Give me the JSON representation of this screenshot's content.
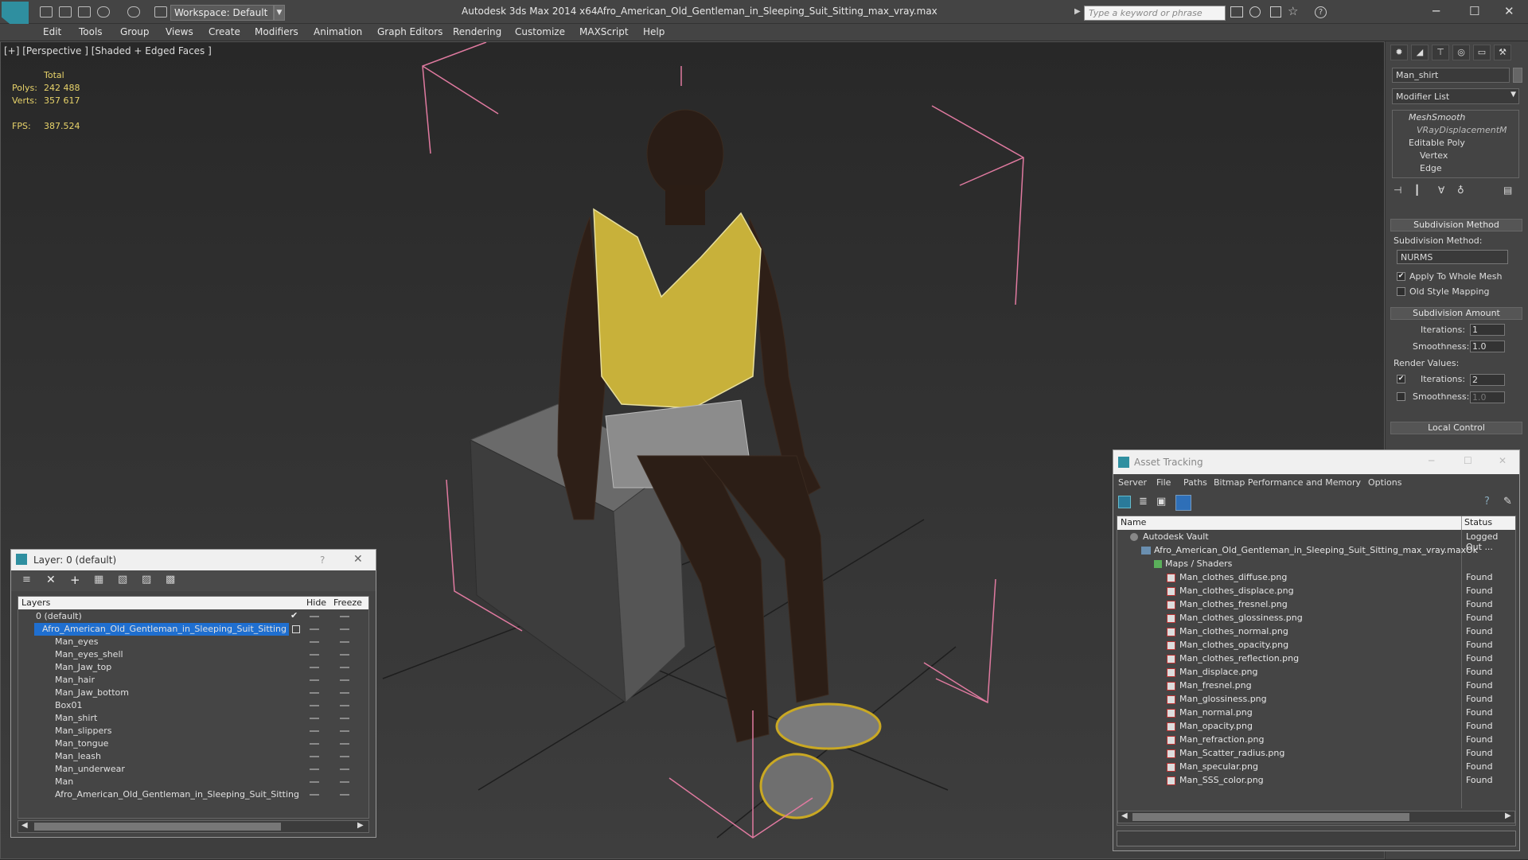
{
  "titlebar": {
    "workspace": "Workspace: Default",
    "app_title": "Autodesk 3ds Max  2014 x64",
    "file_name": "Afro_American_Old_Gentleman_in_Sleeping_Suit_Sitting_max_vray.max",
    "search_placeholder": "Type a keyword or phrase"
  },
  "menu": [
    "Edit",
    "Tools",
    "Group",
    "Views",
    "Create",
    "Modifiers",
    "Animation",
    "Graph Editors",
    "Rendering",
    "Customize",
    "MAXScript",
    "Help"
  ],
  "viewport": {
    "label": "[+] [Perspective ] [Shaded + Edged Faces ]",
    "stats": {
      "total_label": "Total",
      "polys_label": "Polys:",
      "polys": "242 488",
      "verts_label": "Verts:",
      "verts": "357 617",
      "fps_label": "FPS:",
      "fps": "387.524"
    }
  },
  "command_panel": {
    "object_name": "Man_shirt",
    "modifier_list": "Modifier List",
    "stack": [
      "MeshSmooth",
      "VRayDisplacementM",
      "Editable Poly",
      "Vertex",
      "Edge"
    ],
    "subdivision_method_title": "Subdivision Method",
    "subdivision_method_label": "Subdivision Method:",
    "subdivision_method_value": "NURMS",
    "apply_whole_mesh": "Apply To Whole Mesh",
    "old_style_mapping": "Old Style Mapping",
    "subdivision_amount_title": "Subdivision Amount",
    "iterations_label": "Iterations:",
    "iterations_value": "1",
    "smoothness_label": "Smoothness:",
    "smoothness_value": "1.0",
    "render_values_label": "Render Values:",
    "render_iterations_value": "2",
    "render_smoothness_value": "1.0",
    "local_control_title": "Local Control"
  },
  "layer_dialog": {
    "title": "Layer: 0 (default)",
    "help": "?",
    "headers": {
      "layers": "Layers",
      "hide": "Hide",
      "freeze": "Freeze"
    },
    "layers": [
      "0 (default)",
      "Afro_American_Old_Gentleman_in_Sleeping_Suit_Sitting",
      "Man_eyes",
      "Man_eyes_shell",
      "Man_Jaw_top",
      "Man_hair",
      "Man_Jaw_bottom",
      "Box01",
      "Man_shirt",
      "Man_slippers",
      "Man_tongue",
      "Man_leash",
      "Man_underwear",
      "Man",
      "Afro_American_Old_Gentleman_in_Sleeping_Suit_Sitting"
    ]
  },
  "asset_dialog": {
    "title": "Asset Tracking",
    "menu": [
      "Server",
      "File",
      "Paths",
      "Bitmap Performance and Memory",
      "Options"
    ],
    "headers": {
      "name": "Name",
      "status": "Status"
    },
    "rows": [
      {
        "name": "Autodesk Vault",
        "status": "Logged Out ..."
      },
      {
        "name": "Afro_American_Old_Gentleman_in_Sleeping_Suit_Sitting_max_vray.max",
        "status": "Ok"
      },
      {
        "name": "Maps / Shaders",
        "status": ""
      },
      {
        "name": "Man_clothes_diffuse.png",
        "status": "Found"
      },
      {
        "name": "Man_clothes_displace.png",
        "status": "Found"
      },
      {
        "name": "Man_clothes_fresnel.png",
        "status": "Found"
      },
      {
        "name": "Man_clothes_glossiness.png",
        "status": "Found"
      },
      {
        "name": "Man_clothes_normal.png",
        "status": "Found"
      },
      {
        "name": "Man_clothes_opacity.png",
        "status": "Found"
      },
      {
        "name": "Man_clothes_reflection.png",
        "status": "Found"
      },
      {
        "name": "Man_displace.png",
        "status": "Found"
      },
      {
        "name": "Man_fresnel.png",
        "status": "Found"
      },
      {
        "name": "Man_glossiness.png",
        "status": "Found"
      },
      {
        "name": "Man_normal.png",
        "status": "Found"
      },
      {
        "name": "Man_opacity.png",
        "status": "Found"
      },
      {
        "name": "Man_refraction.png",
        "status": "Found"
      },
      {
        "name": "Man_Scatter_radius.png",
        "status": "Found"
      },
      {
        "name": "Man_specular.png",
        "status": "Found"
      },
      {
        "name": "Man_SSS_color.png",
        "status": "Found"
      }
    ]
  }
}
